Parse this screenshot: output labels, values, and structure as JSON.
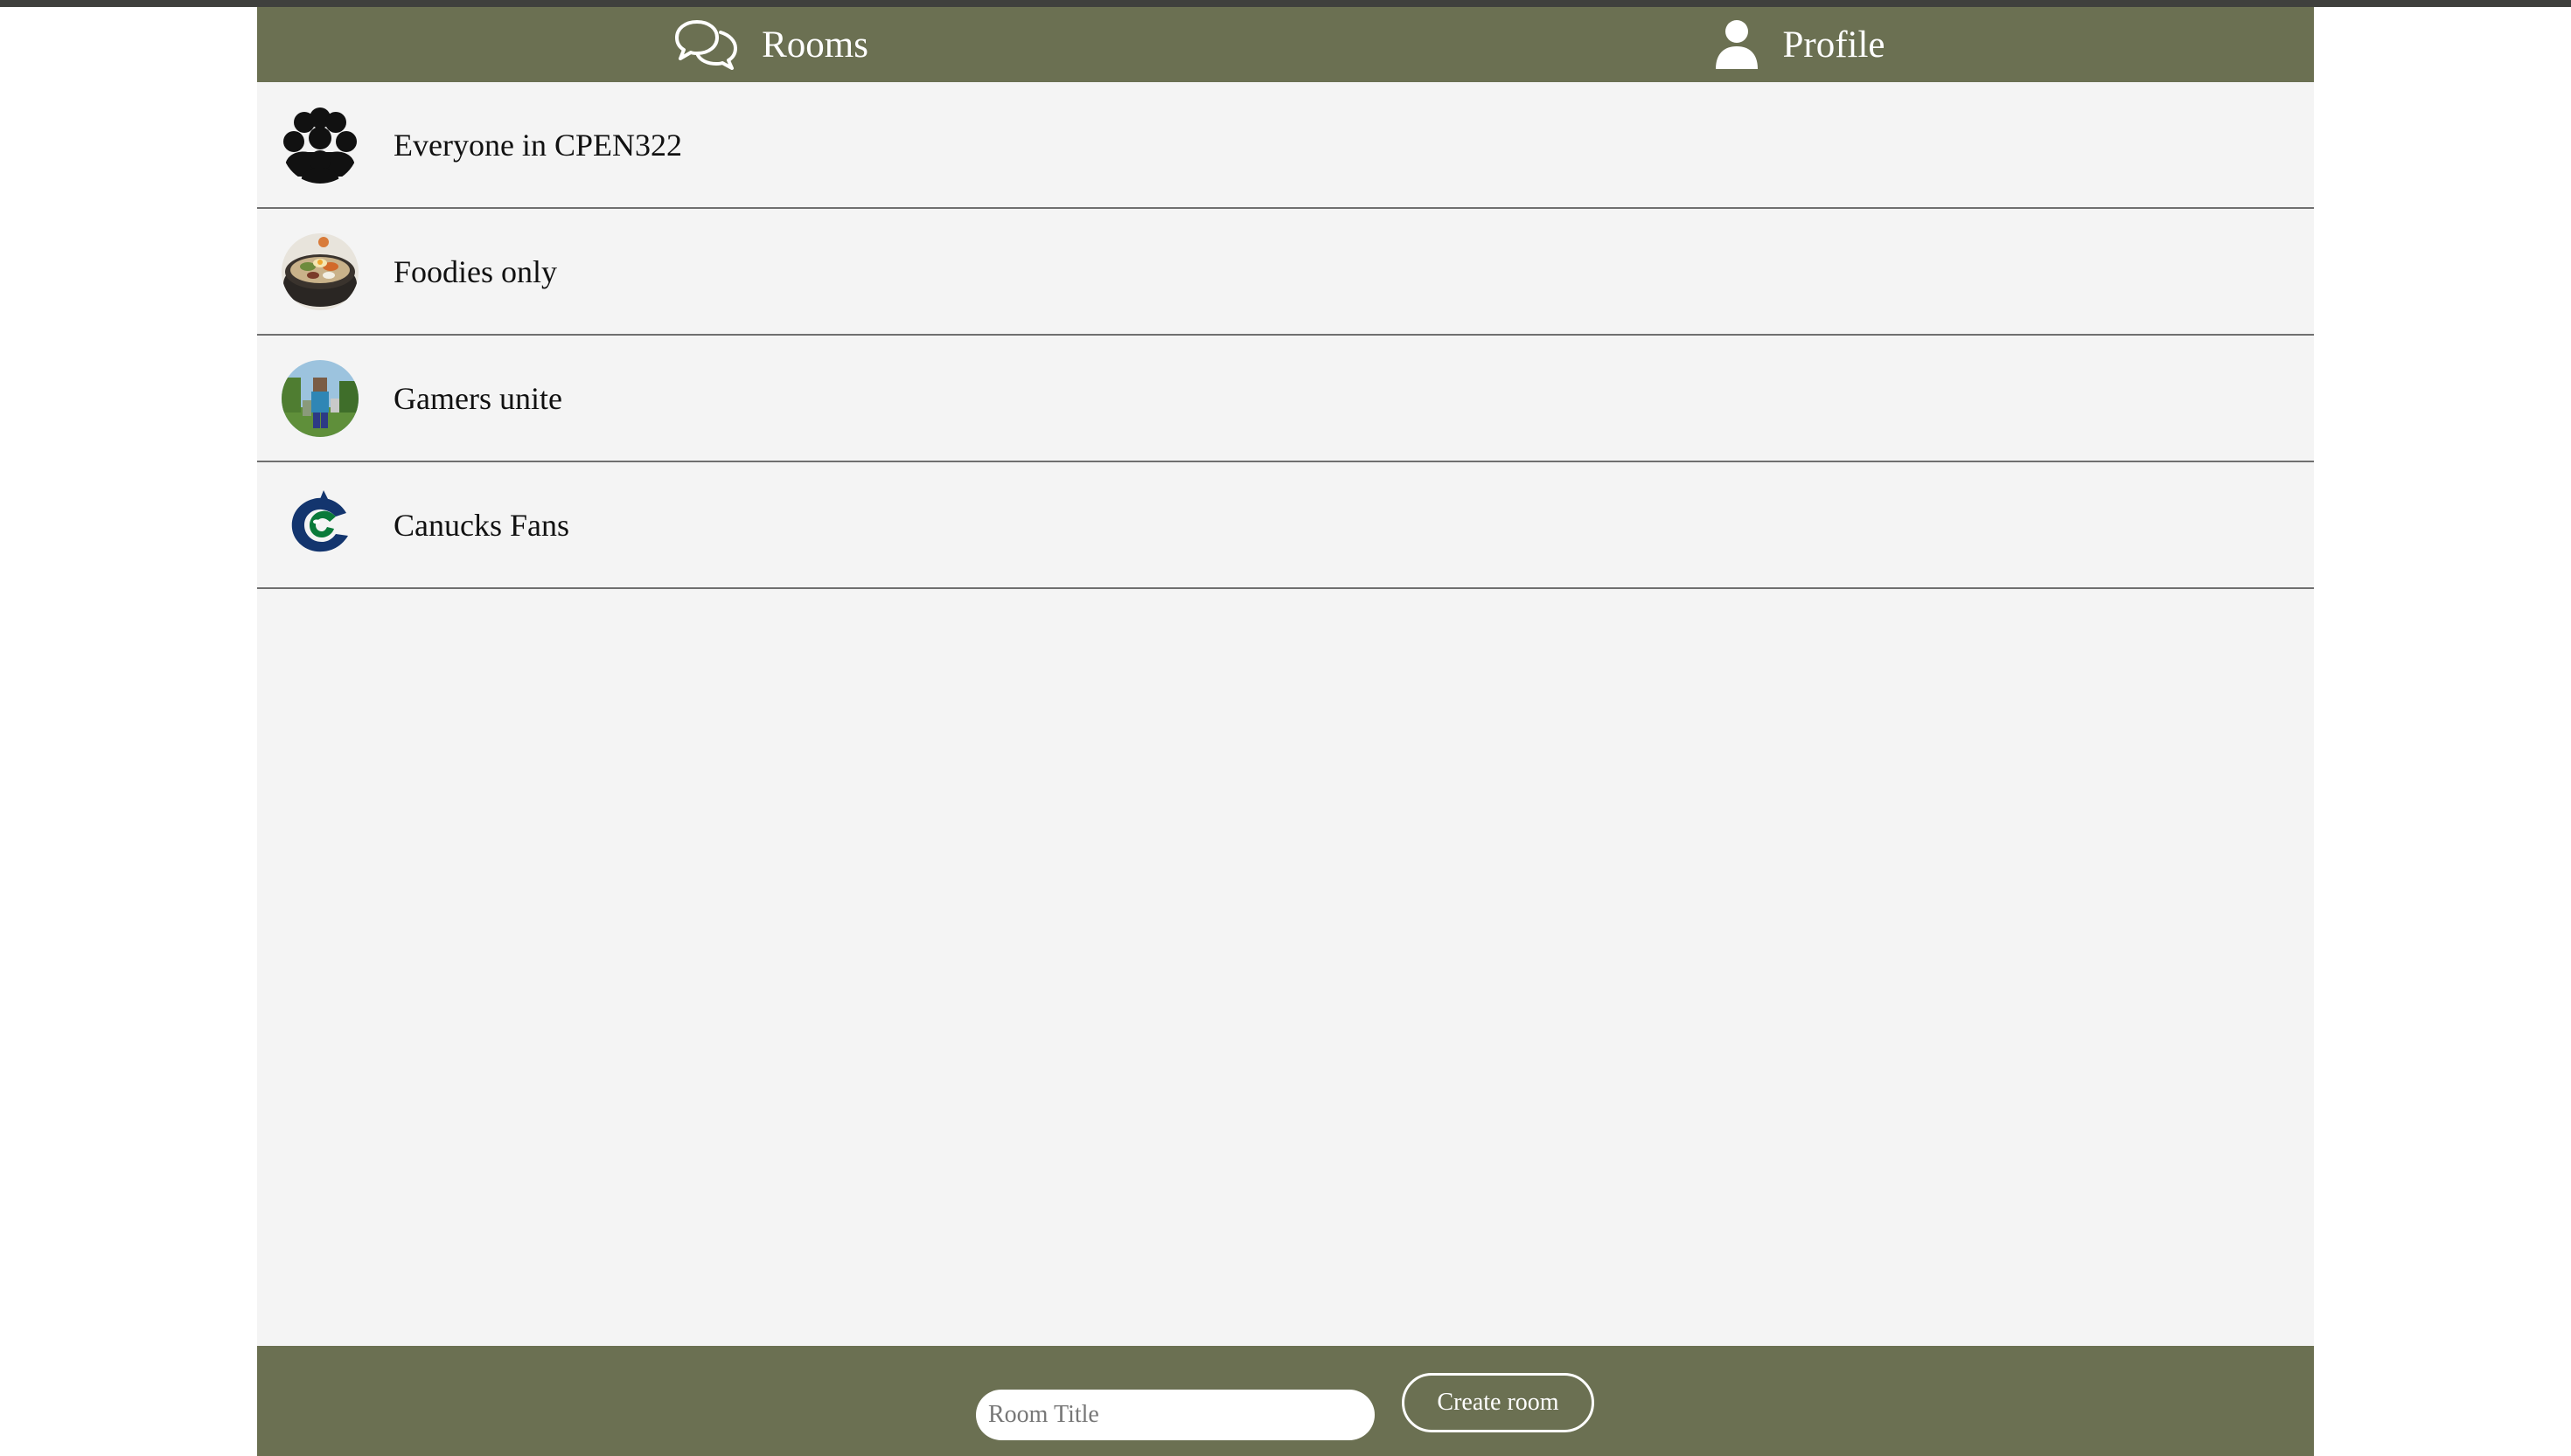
{
  "menu": {
    "rooms_label": "Rooms",
    "profile_label": "Profile",
    "rooms_icon": "chat-bubbles-icon",
    "profile_icon": "person-icon"
  },
  "rooms": [
    {
      "name": "Everyone in CPEN322",
      "image": "group-of-people-icon"
    },
    {
      "name": "Foodies only",
      "image": "bibimbap-bowl-photo"
    },
    {
      "name": "Gamers unite",
      "image": "minecraft-scene-photo"
    },
    {
      "name": "Canucks Fans",
      "image": "canucks-orca-logo"
    }
  ],
  "footer": {
    "room_title_placeholder": "Room Title",
    "create_button_label": "Create room"
  },
  "colors": {
    "header_footer": "#6b7052",
    "content_background": "#f4f4f4",
    "top_strip": "#3f403d"
  }
}
